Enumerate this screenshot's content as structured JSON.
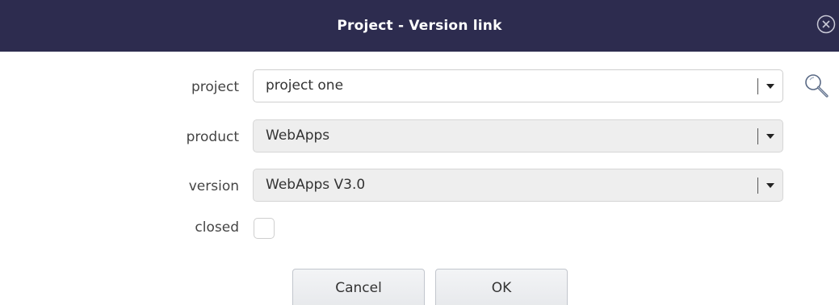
{
  "dialog": {
    "title": "Project - Version link",
    "close_icon": "close-circle-icon"
  },
  "form": {
    "project": {
      "label": "project",
      "value": "project one",
      "enabled": true,
      "lookup_icon": "search-icon"
    },
    "product": {
      "label": "product",
      "value": "WebApps",
      "enabled": false
    },
    "version": {
      "label": "version",
      "value": "WebApps V3.0",
      "enabled": false
    },
    "closed": {
      "label": "closed",
      "checked": false
    }
  },
  "buttons": {
    "cancel_label": "Cancel",
    "ok_label": "OK"
  },
  "colors": {
    "title_bar": "#2d2c4f",
    "title_text": "#ffffff",
    "disabled_field": "#eeeeee",
    "border": "#cfcfcf"
  }
}
